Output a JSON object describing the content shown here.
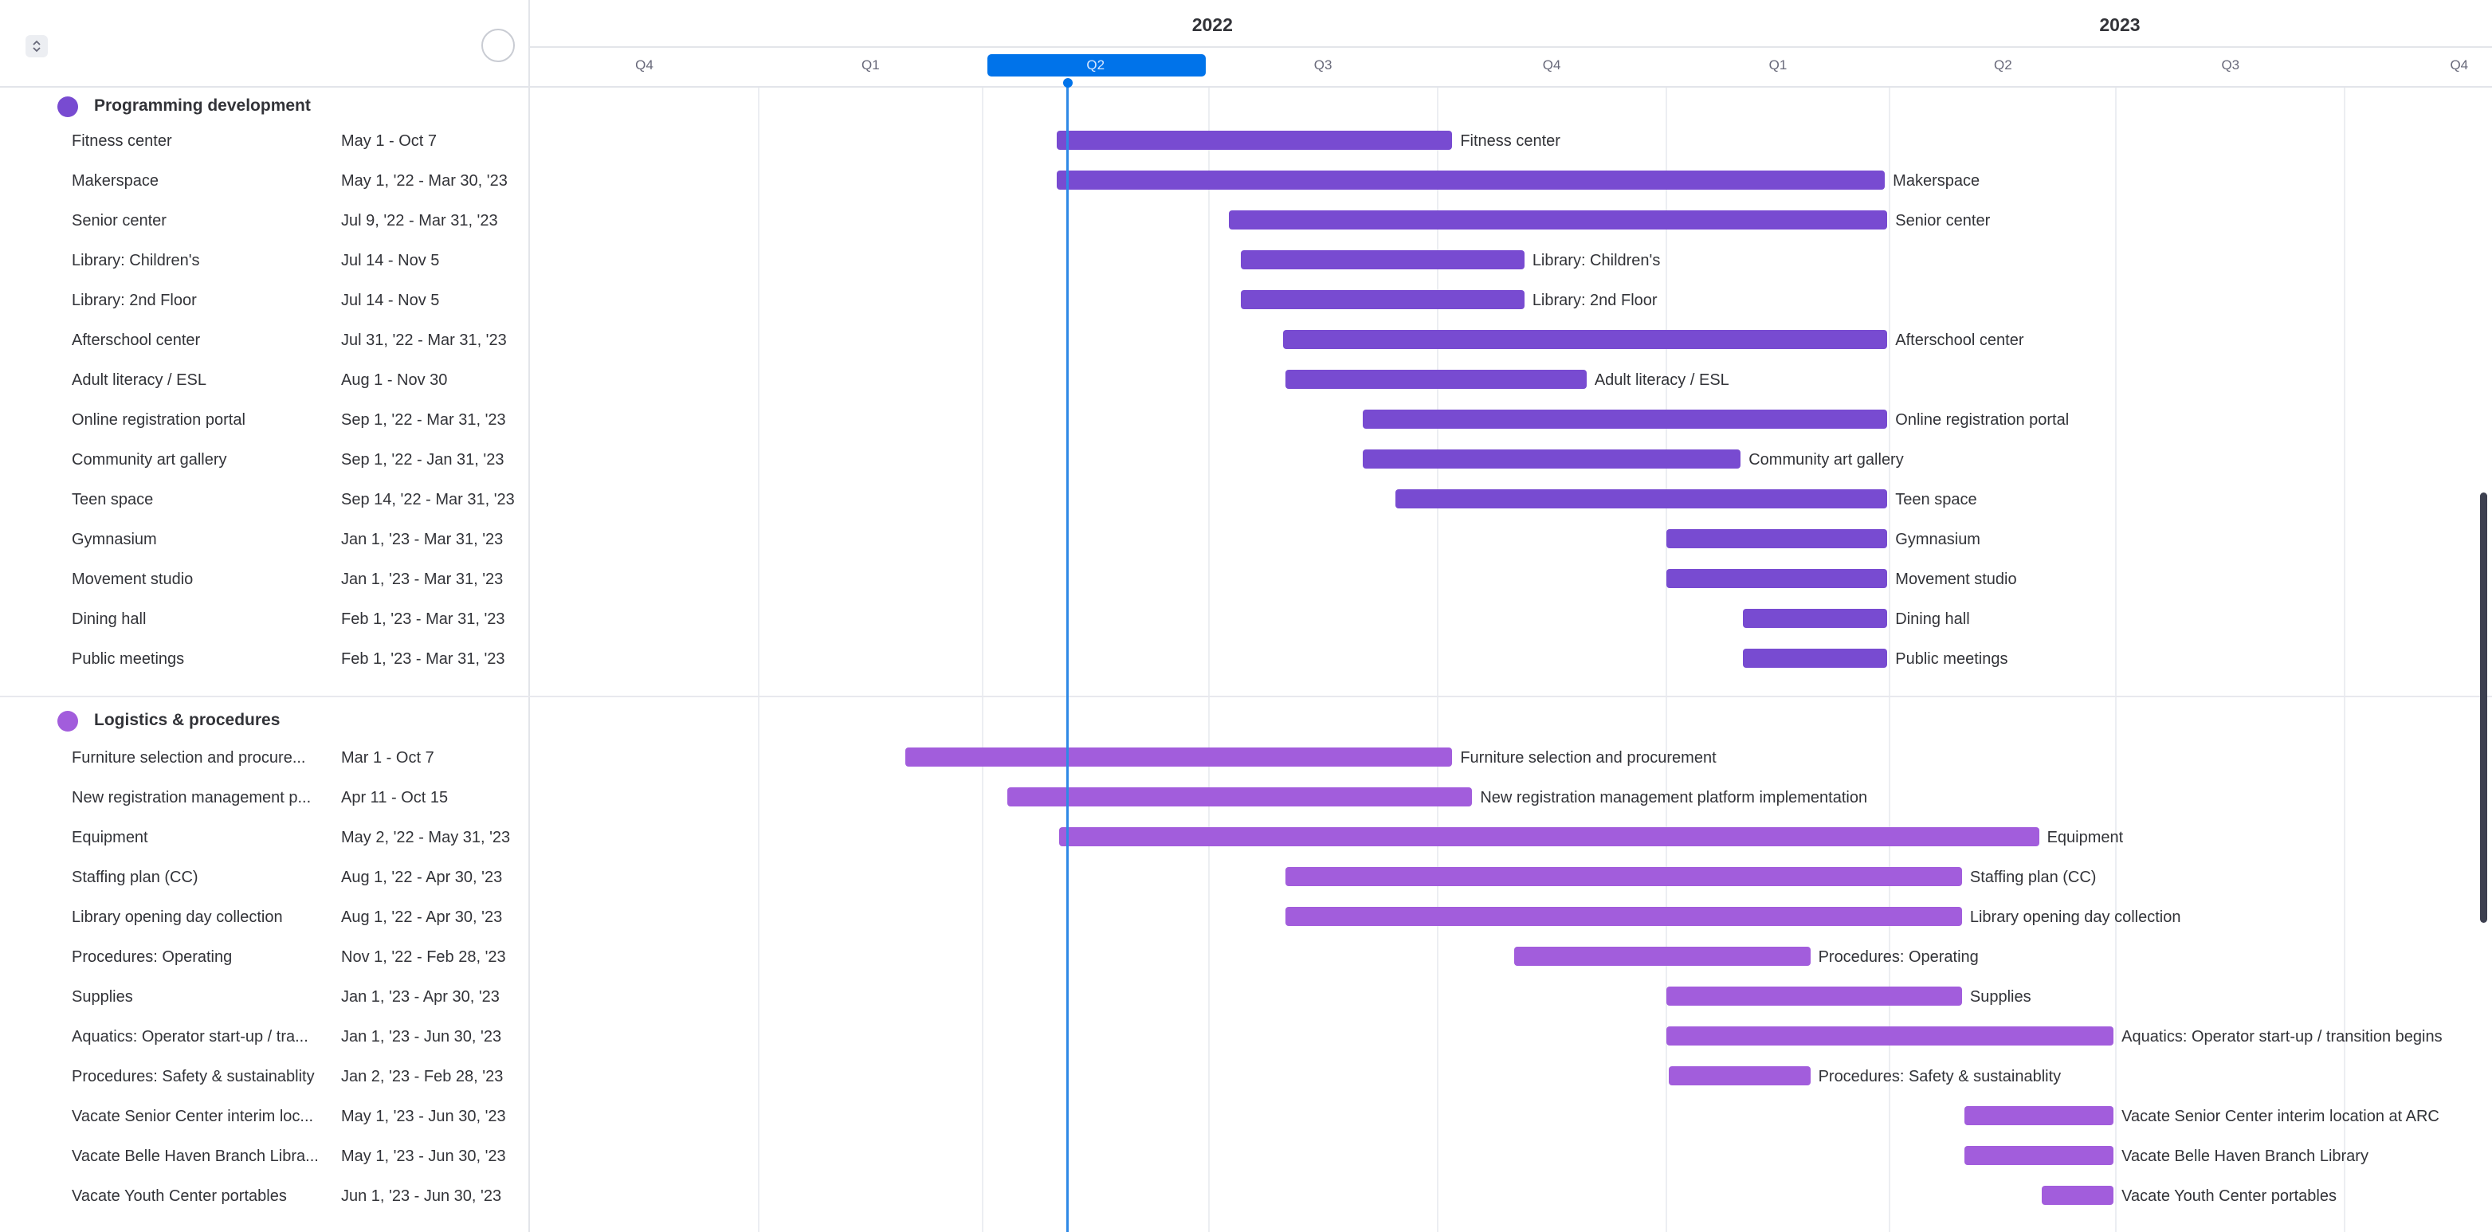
{
  "header": {
    "years": [
      {
        "label": "2022"
      },
      {
        "label": "2023"
      }
    ],
    "quarters": [
      "Q4",
      "Q1",
      "Q2",
      "Q3",
      "Q4",
      "Q1",
      "Q2",
      "Q3",
      "Q4"
    ],
    "today_quarter": "Q2"
  },
  "groups": [
    {
      "title": "Programming development",
      "color": "#784bd1",
      "tasks": [
        {
          "name": "Fitness center",
          "dates": "May 1 - Oct 7",
          "label": "Fitness center",
          "start": "2022-05-01",
          "end": "2022-10-07"
        },
        {
          "name": "Makerspace",
          "dates": "May 1, '22 - Mar 30, '23",
          "label": "Makerspace",
          "start": "2022-05-01",
          "end": "2023-03-30"
        },
        {
          "name": "Senior center",
          "dates": "Jul 9, '22 - Mar 31, '23",
          "label": "Senior center",
          "start": "2022-07-09",
          "end": "2023-03-31"
        },
        {
          "name": "Library: Children's",
          "dates": "Jul 14 - Nov 5",
          "label": "Library: Children's",
          "start": "2022-07-14",
          "end": "2022-11-05"
        },
        {
          "name": "Library: 2nd Floor",
          "dates": "Jul 14 - Nov 5",
          "label": "Library: 2nd Floor",
          "start": "2022-07-14",
          "end": "2022-11-05"
        },
        {
          "name": "Afterschool center",
          "dates": "Jul 31, '22 - Mar 31, '23",
          "label": "Afterschool center",
          "start": "2022-07-31",
          "end": "2023-03-31"
        },
        {
          "name": "Adult literacy / ESL",
          "dates": "Aug 1 - Nov 30",
          "label": "Adult literacy / ESL",
          "start": "2022-08-01",
          "end": "2022-11-30"
        },
        {
          "name": "Online registration portal",
          "dates": "Sep 1, '22 - Mar 31, '23",
          "label": "Online registration portal",
          "start": "2022-09-01",
          "end": "2023-03-31"
        },
        {
          "name": "Community art gallery",
          "dates": "Sep 1, '22 - Jan 31, '23",
          "label": "Community art gallery",
          "start": "2022-09-01",
          "end": "2023-01-31"
        },
        {
          "name": "Teen space",
          "dates": "Sep 14, '22 - Mar 31, '23",
          "label": "Teen space",
          "start": "2022-09-14",
          "end": "2023-03-31"
        },
        {
          "name": "Gymnasium",
          "dates": "Jan 1, '23 - Mar 31, '23",
          "label": "Gymnasium",
          "start": "2023-01-01",
          "end": "2023-03-31"
        },
        {
          "name": "Movement studio",
          "dates": "Jan 1, '23 - Mar 31, '23",
          "label": "Movement studio",
          "start": "2023-01-01",
          "end": "2023-03-31"
        },
        {
          "name": "Dining hall",
          "dates": "Feb 1, '23 - Mar 31, '23",
          "label": "Dining hall",
          "start": "2023-02-01",
          "end": "2023-03-31"
        },
        {
          "name": "Public meetings",
          "dates": "Feb 1, '23 - Mar 31, '23",
          "label": "Public meetings",
          "start": "2023-02-01",
          "end": "2023-03-31"
        }
      ]
    },
    {
      "title": "Logistics & procedures",
      "color": "#a25ddc",
      "tasks": [
        {
          "name": "Furniture selection and procure...",
          "dates": "Mar 1 - Oct 7",
          "label": "Furniture selection and procurement",
          "start": "2022-03-01",
          "end": "2022-10-07"
        },
        {
          "name": "New registration management p...",
          "dates": "Apr 11 - Oct 15",
          "label": "New registration management platform implementation",
          "start": "2022-04-11",
          "end": "2022-10-15"
        },
        {
          "name": "Equipment",
          "dates": "May 2, '22 - May 31, '23",
          "label": "Equipment",
          "start": "2022-05-02",
          "end": "2023-05-31"
        },
        {
          "name": "Staffing plan (CC)",
          "dates": "Aug 1, '22 - Apr 30, '23",
          "label": "Staffing plan (CC)",
          "start": "2022-08-01",
          "end": "2023-04-30"
        },
        {
          "name": "Library opening day collection",
          "dates": "Aug 1, '22 - Apr 30, '23",
          "label": "Library opening day collection",
          "start": "2022-08-01",
          "end": "2023-04-30"
        },
        {
          "name": "Procedures: Operating",
          "dates": "Nov 1, '22 - Feb 28, '23",
          "label": "Procedures: Operating",
          "start": "2022-11-01",
          "end": "2023-02-28"
        },
        {
          "name": "Supplies",
          "dates": "Jan 1, '23 - Apr 30, '23",
          "label": "Supplies",
          "start": "2023-01-01",
          "end": "2023-04-30"
        },
        {
          "name": "Aquatics: Operator start-up / tra...",
          "dates": "Jan 1, '23 - Jun 30, '23",
          "label": "Aquatics: Operator start-up / transition begins",
          "start": "2023-01-01",
          "end": "2023-06-30"
        },
        {
          "name": "Procedures: Safety & sustainablity",
          "dates": "Jan 2, '23 - Feb 28, '23",
          "label": "Procedures: Safety & sustainablity",
          "start": "2023-01-02",
          "end": "2023-02-28"
        },
        {
          "name": "Vacate Senior Center interim loc...",
          "dates": "May 1, '23 - Jun 30, '23",
          "label": "Vacate Senior Center interim location at ARC",
          "start": "2023-05-01",
          "end": "2023-06-30"
        },
        {
          "name": "Vacate Belle Haven Branch Libra...",
          "dates": "May 1, '23 - Jun 30, '23",
          "label": "Vacate Belle Haven Branch Library",
          "start": "2023-05-01",
          "end": "2023-06-30"
        },
        {
          "name": "Vacate Youth Center portables",
          "dates": "Jun 1, '23 - Jun 30, '23",
          "label": "Vacate Youth Center portables",
          "start": "2023-06-01",
          "end": "2023-06-30"
        }
      ]
    }
  ]
}
